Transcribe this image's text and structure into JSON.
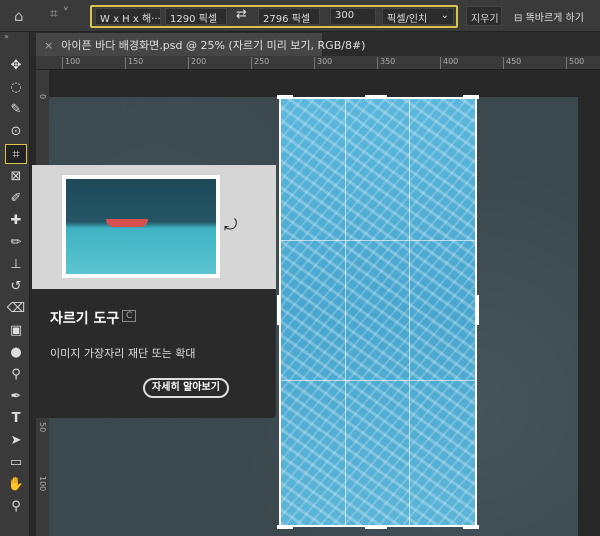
{
  "options_bar": {
    "ratio_select": "W x H x 해···",
    "width": "1290 픽셀",
    "height": "2796 픽셀",
    "resolution": "300",
    "resolution_unit": "픽셀/인치",
    "clear": "지우기",
    "straighten": "똑바르게 하기",
    "accent": "#d9c34a"
  },
  "document_tab": {
    "title": "아이픈 바다 배경화면.psd @ 25% (자르기 미리 보기, RGB/8#)",
    "close": "×"
  },
  "ruler": {
    "h": [
      "100",
      "150",
      "200",
      "250",
      "300",
      "350",
      "400",
      "450",
      "500"
    ],
    "v": [
      "0",
      "50",
      "100"
    ]
  },
  "tooltip": {
    "title": "자르기 도구",
    "shortcut": "C",
    "description": "이미지 가장자리 재단 또는 확대",
    "learn_more": "자세히 알아보기"
  },
  "tools": [
    "move",
    "lasso",
    "quick-select",
    "object-select",
    "crop",
    "frame",
    "eyedropper",
    "healing",
    "brush",
    "stamp",
    "history-brush",
    "eraser",
    "gradient",
    "blur",
    "dodge",
    "pen",
    "type",
    "path-select",
    "rectangle",
    "hand",
    "zoom"
  ]
}
